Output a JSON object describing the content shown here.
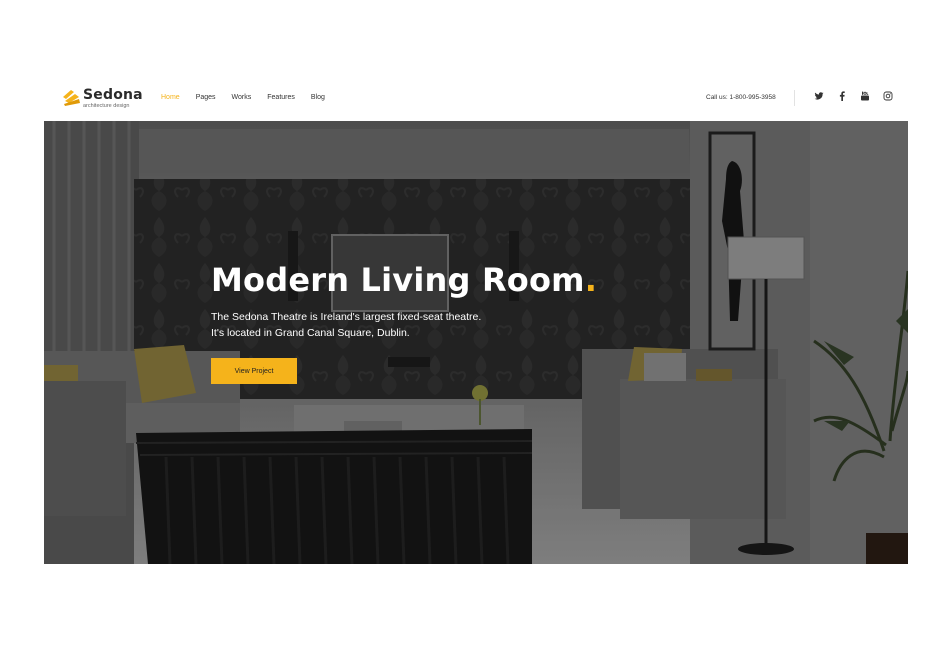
{
  "brand": {
    "name": "Sedona",
    "tagline": "architecture design",
    "accent_color": "#f5b31b"
  },
  "nav": {
    "items": [
      {
        "label": "Home",
        "active": true
      },
      {
        "label": "Pages",
        "active": false
      },
      {
        "label": "Works",
        "active": false
      },
      {
        "label": "Features",
        "active": false
      },
      {
        "label": "Blog",
        "active": false
      }
    ]
  },
  "contact": {
    "call_text": "Call us: 1-800-995-3958"
  },
  "social": {
    "icons": [
      "twitter-icon",
      "facebook-icon",
      "youtube-icon",
      "instagram-icon"
    ]
  },
  "hero": {
    "title": "Modern Living Room",
    "title_dot": ".",
    "text_line1": "The Sedona Theatre is Ireland's largest fixed-seat theatre.",
    "text_line2": "It's located in Grand Canal Square, Dublin.",
    "button_label": "View Project"
  }
}
